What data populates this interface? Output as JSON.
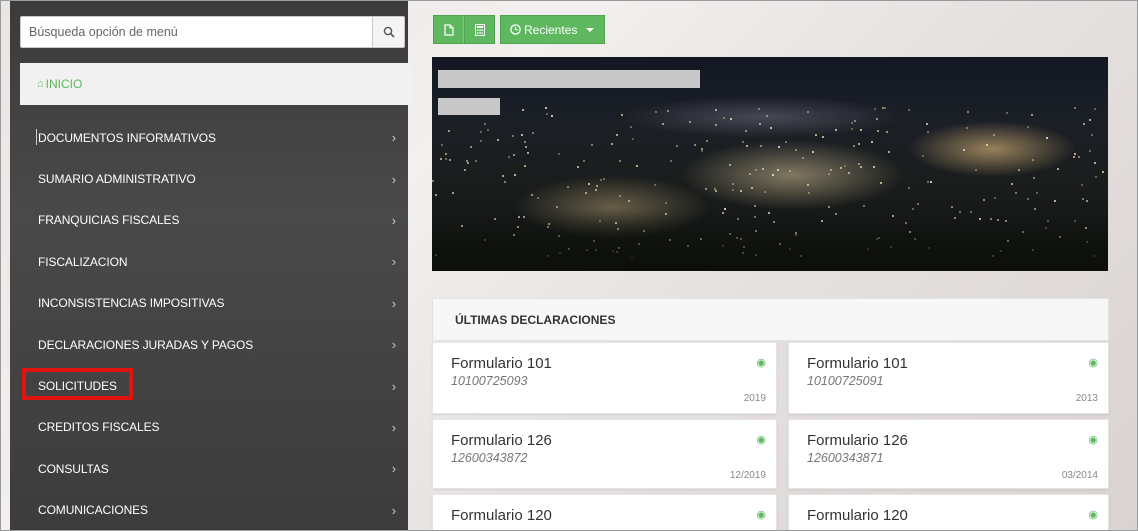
{
  "search": {
    "placeholder": "Búsqueda opción de menú",
    "button_icon": "search-icon"
  },
  "sidebar": {
    "home_label": "INICIO",
    "items": [
      {
        "label": "DOCUMENTOS INFORMATIVOS"
      },
      {
        "label": "SUMARIO ADMINISTRATIVO"
      },
      {
        "label": "FRANQUICIAS FISCALES"
      },
      {
        "label": "FISCALIZACION"
      },
      {
        "label": "INCONSISTENCIAS IMPOSITIVAS"
      },
      {
        "label": "DECLARACIONES JURADAS Y PAGOS"
      },
      {
        "label": "SOLICITUDES"
      },
      {
        "label": "CREDITOS FISCALES"
      },
      {
        "label": "CONSULTAS"
      },
      {
        "label": "COMUNICACIONES"
      }
    ],
    "highlighted_item": "SOLICITUDES",
    "highlight_color": "#e0140f"
  },
  "toolbar": {
    "recent_label": "Recientes",
    "buttons": [
      "file-icon",
      "calculator-icon"
    ],
    "color": "#5fb760"
  },
  "declarations": {
    "header": "ÚLTIMAS DECLARACIONES",
    "cards": [
      {
        "title": "Formulario 101",
        "number": "10100725093",
        "period": "2019"
      },
      {
        "title": "Formulario 101",
        "number": "10100725091",
        "period": "2013"
      },
      {
        "title": "Formulario 126",
        "number": "12600343872",
        "period": "12/2019"
      },
      {
        "title": "Formulario 126",
        "number": "12600343871",
        "period": "03/2014"
      },
      {
        "title": "Formulario 120",
        "number": "",
        "period": ""
      },
      {
        "title": "Formulario 120",
        "number": "",
        "period": ""
      }
    ]
  },
  "colors": {
    "accent": "#5cb85c",
    "sidebar_bg": "#424141"
  }
}
